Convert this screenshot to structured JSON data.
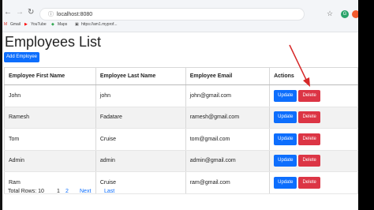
{
  "browser": {
    "url": "localhost:8080",
    "bookmarks": [
      {
        "label": "Gmail",
        "icon": "gmail-icon"
      },
      {
        "label": "YouTube",
        "icon": "youtube-icon"
      },
      {
        "label": "Maps",
        "icon": "maps-icon"
      },
      {
        "label": "https://am1.myprof...",
        "icon": "link-icon"
      }
    ],
    "extension_badge": "G"
  },
  "page": {
    "title": "Employees List",
    "add_button": "Add Employee"
  },
  "table": {
    "headers": [
      "Employee First Name",
      "Employee Last Name",
      "Employee Email",
      "Actions"
    ],
    "rows": [
      {
        "first": "John",
        "last": "john",
        "email": "john@gmail.com"
      },
      {
        "first": "Ramesh",
        "last": "Fadatare",
        "email": "ramesh@gmail.com"
      },
      {
        "first": "Tom",
        "last": "Cruise",
        "email": "tom@gmail.com"
      },
      {
        "first": "Admin",
        "last": "admin",
        "email": "admin@gmail.com"
      },
      {
        "first": "Ram",
        "last": "Cruise",
        "email": "ram@gmail.com"
      }
    ],
    "update_label": "Update",
    "delete_label": "Delete"
  },
  "footer": {
    "total": "Total Rows: 10",
    "pages": [
      "1",
      "2"
    ],
    "next": "Next",
    "last": "Last"
  },
  "colors": {
    "primary": "#0d6efd",
    "danger": "#dc3545",
    "annotation": "#d62828"
  }
}
